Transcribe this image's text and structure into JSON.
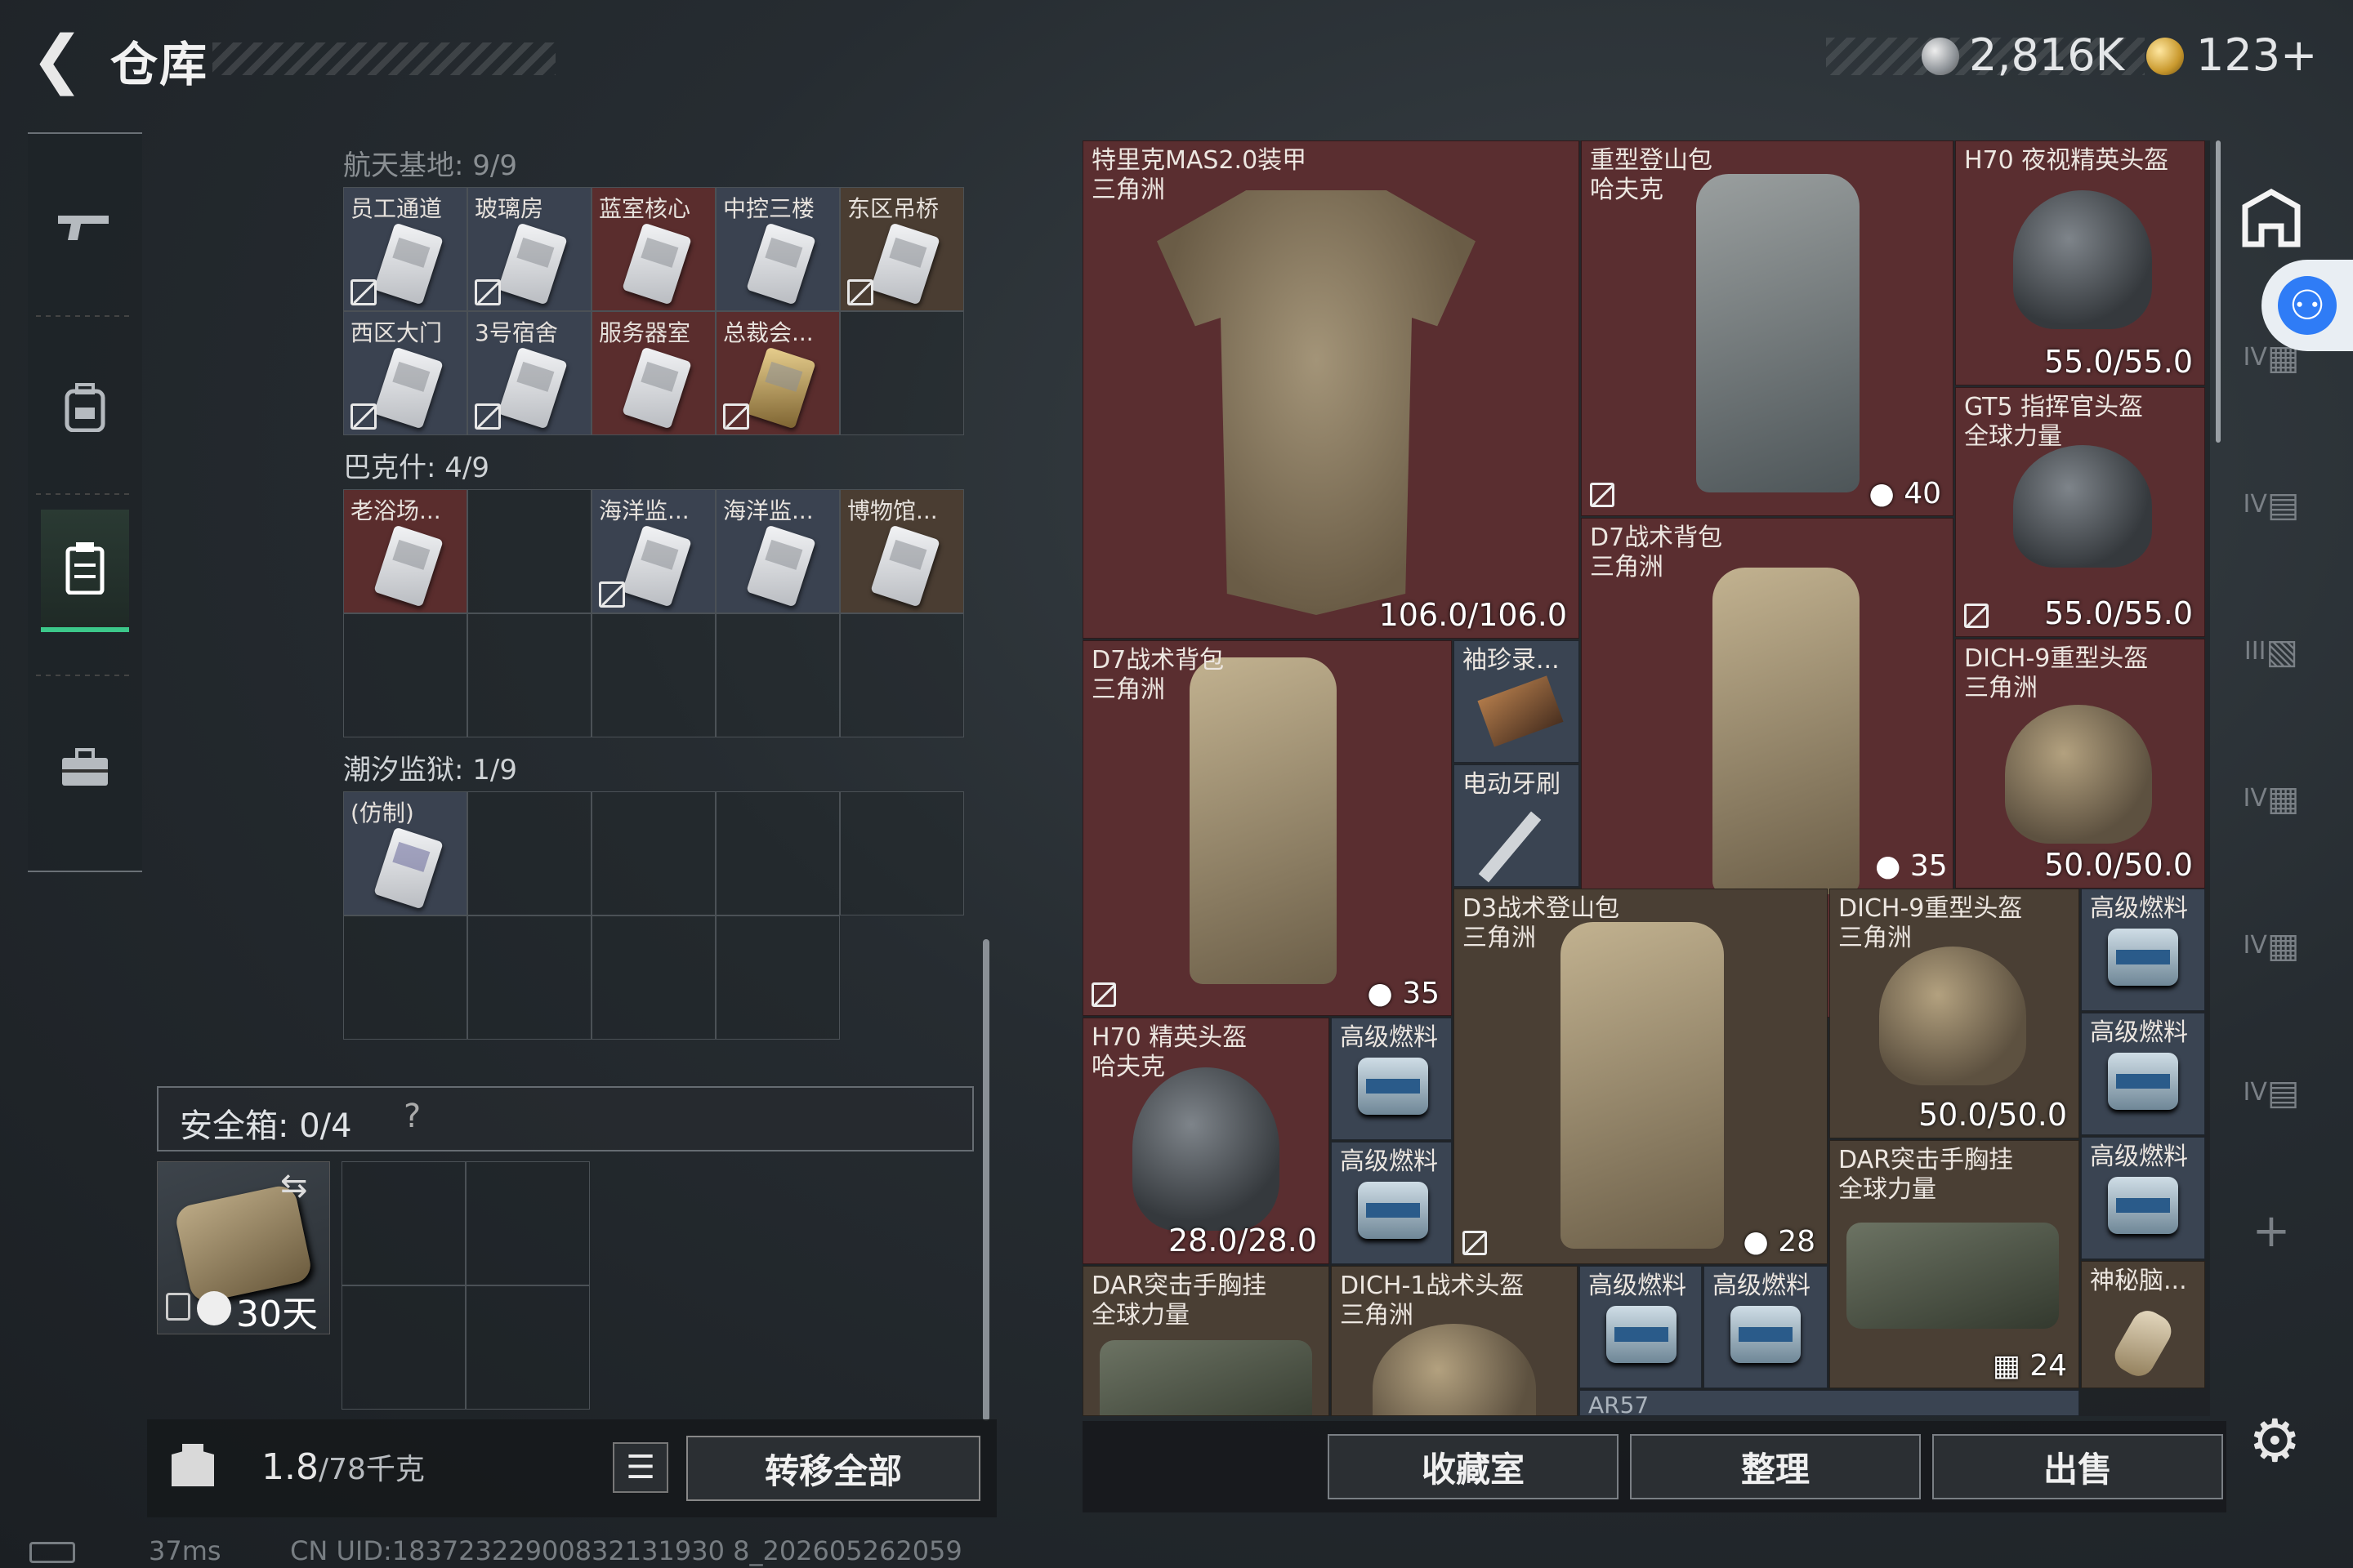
{
  "header": {
    "title": "仓库",
    "money": "2,816K",
    "coupons": "123+"
  },
  "left_nav": [
    "weapon-icon",
    "backpack-icon",
    "storage-icon",
    "toolbox-icon"
  ],
  "warehouse": {
    "sections": [
      {
        "title": "航天基地: 9/9",
        "rows": [
          [
            {
              "label": "员工通道",
              "color": "blue",
              "locked": true
            },
            {
              "label": "玻璃房",
              "color": "blue",
              "locked": true
            },
            {
              "label": "蓝室核心",
              "color": "red",
              "locked": false
            },
            {
              "label": "中控三楼",
              "color": "blue",
              "locked": false
            },
            {
              "label": "东区吊桥",
              "color": "brown",
              "locked": true
            }
          ],
          [
            {
              "label": "西区大门",
              "color": "blue",
              "locked": true
            },
            {
              "label": "3号宿舍",
              "color": "blue",
              "locked": true
            },
            {
              "label": "服务器室",
              "color": "red",
              "locked": false
            },
            {
              "label": "总裁会...",
              "color": "red",
              "locked": true,
              "gold": true
            },
            null
          ]
        ]
      },
      {
        "title": "巴克什: 4/9",
        "rows": [
          [
            {
              "label": "老浴场...",
              "color": "red",
              "locked": false
            },
            null,
            {
              "label": "海洋监...",
              "color": "blue",
              "locked": true
            },
            {
              "label": "海洋监...",
              "color": "blue",
              "locked": false
            },
            {
              "label": "博物馆...",
              "color": "brown",
              "locked": false
            }
          ],
          [
            null,
            null,
            null,
            null,
            null
          ]
        ]
      },
      {
        "title": "潮汐监狱: 1/9",
        "rows": [
          [
            {
              "label": "(仿制)",
              "color": "blue",
              "locked": false,
              "purple": true
            },
            null,
            null,
            null,
            null
          ],
          [
            null,
            null,
            null,
            null
          ]
        ]
      }
    ]
  },
  "safebox": {
    "label": "安全箱: 0/4",
    "help": "?",
    "days": "30天"
  },
  "weight": {
    "current": "1.8",
    "max": "/78千克"
  },
  "buttons": {
    "transfer_all": "转移全部",
    "collection": "收藏室",
    "organize": "整理",
    "sell": "出售"
  },
  "status": {
    "ping": "37ms",
    "uid": "CN UID:18372322900832131930 8_202605262059"
  },
  "stash_items": {
    "vest": {
      "name": "特里克MAS2.0装甲",
      "sub": "三角洲",
      "durability": "106.0/106.0"
    },
    "heavy_pack": {
      "name": "重型登山包",
      "sub": "哈夫克",
      "capacity": "40"
    },
    "h70_nv": {
      "name": "H70 夜视精英头盔",
      "durability": "55.0/55.0"
    },
    "gt5": {
      "name": "GT5 指挥官头盔",
      "sub": "全球力量",
      "durability": "55.0/55.0"
    },
    "d7_a": {
      "name": "D7战术背包",
      "sub": "三角洲",
      "capacity": "35"
    },
    "d7_b": {
      "name": "D7战术背包",
      "sub": "三角洲",
      "capacity": "35"
    },
    "dich9_a": {
      "name": "DICH-9重型头盔",
      "sub": "三角洲",
      "durability": "50.0/50.0"
    },
    "xiuzhen": {
      "name": "袖珍录..."
    },
    "toothbrush": {
      "name": "电动牙刷"
    },
    "d3": {
      "name": "D3战术登山包",
      "sub": "三角洲",
      "capacity": "28"
    },
    "dich9_b": {
      "name": "DICH-9重型头盔",
      "sub": "三角洲",
      "durability": "50.0/50.0"
    },
    "fuel": {
      "name": "高级燃料"
    },
    "h70": {
      "name": "H70 精英头盔",
      "sub": "哈夫克",
      "durability": "28.0/28.0"
    },
    "dar_a": {
      "name": "DAR突击手胸挂",
      "sub": "全球力量",
      "capacity": "24"
    },
    "dar_b": {
      "name": "DAR突击手胸挂",
      "sub": "全球力量"
    },
    "dich1": {
      "name": "DICH-1战术头盔",
      "sub": "三角洲"
    },
    "mystery": {
      "name": "神秘脑..."
    },
    "ar57": {
      "name": "AR57"
    }
  },
  "right_rail": {
    "tiers": [
      "IV",
      "IV",
      "III",
      "IV",
      "IV",
      "IV"
    ],
    "add": "+"
  },
  "colors": {
    "accent": "#3cc88a",
    "rare_red": "#5a2e30",
    "rare_blue": "#3a4452",
    "rare_brown": "#4a3f34"
  }
}
